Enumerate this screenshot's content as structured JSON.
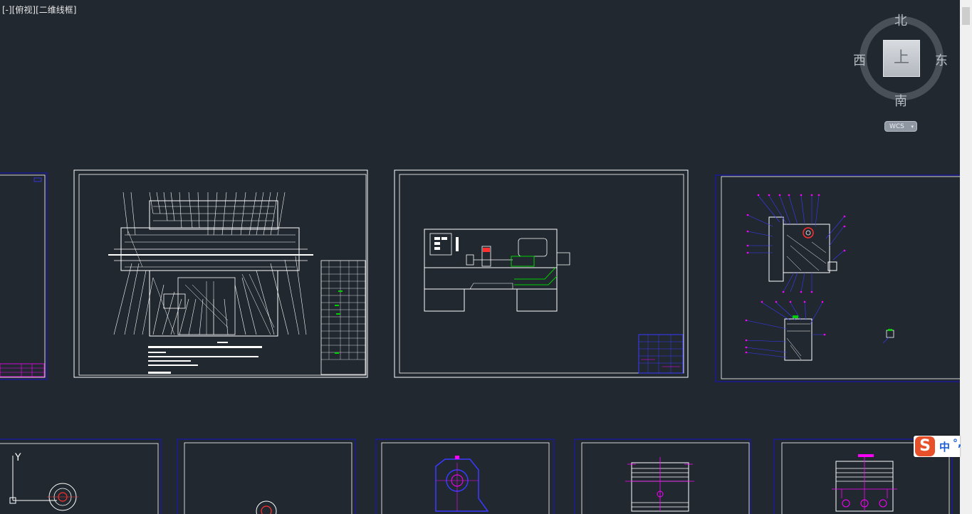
{
  "viewport": {
    "control": "[-]",
    "view": "[俯视]",
    "visual_style": "[二维线框]"
  },
  "viewcube": {
    "north": "北",
    "south": "南",
    "east": "东",
    "west": "西",
    "face": "上",
    "wcs": "WCS"
  },
  "ime": {
    "logo": "S",
    "mode": "中",
    "punct": "°,"
  },
  "colors": {
    "background": "#212830",
    "frame_blue": "#1515c8",
    "line_white": "#ffffff",
    "magenta": "#ff00ff",
    "green": "#00d000",
    "red": "#ff3030"
  }
}
